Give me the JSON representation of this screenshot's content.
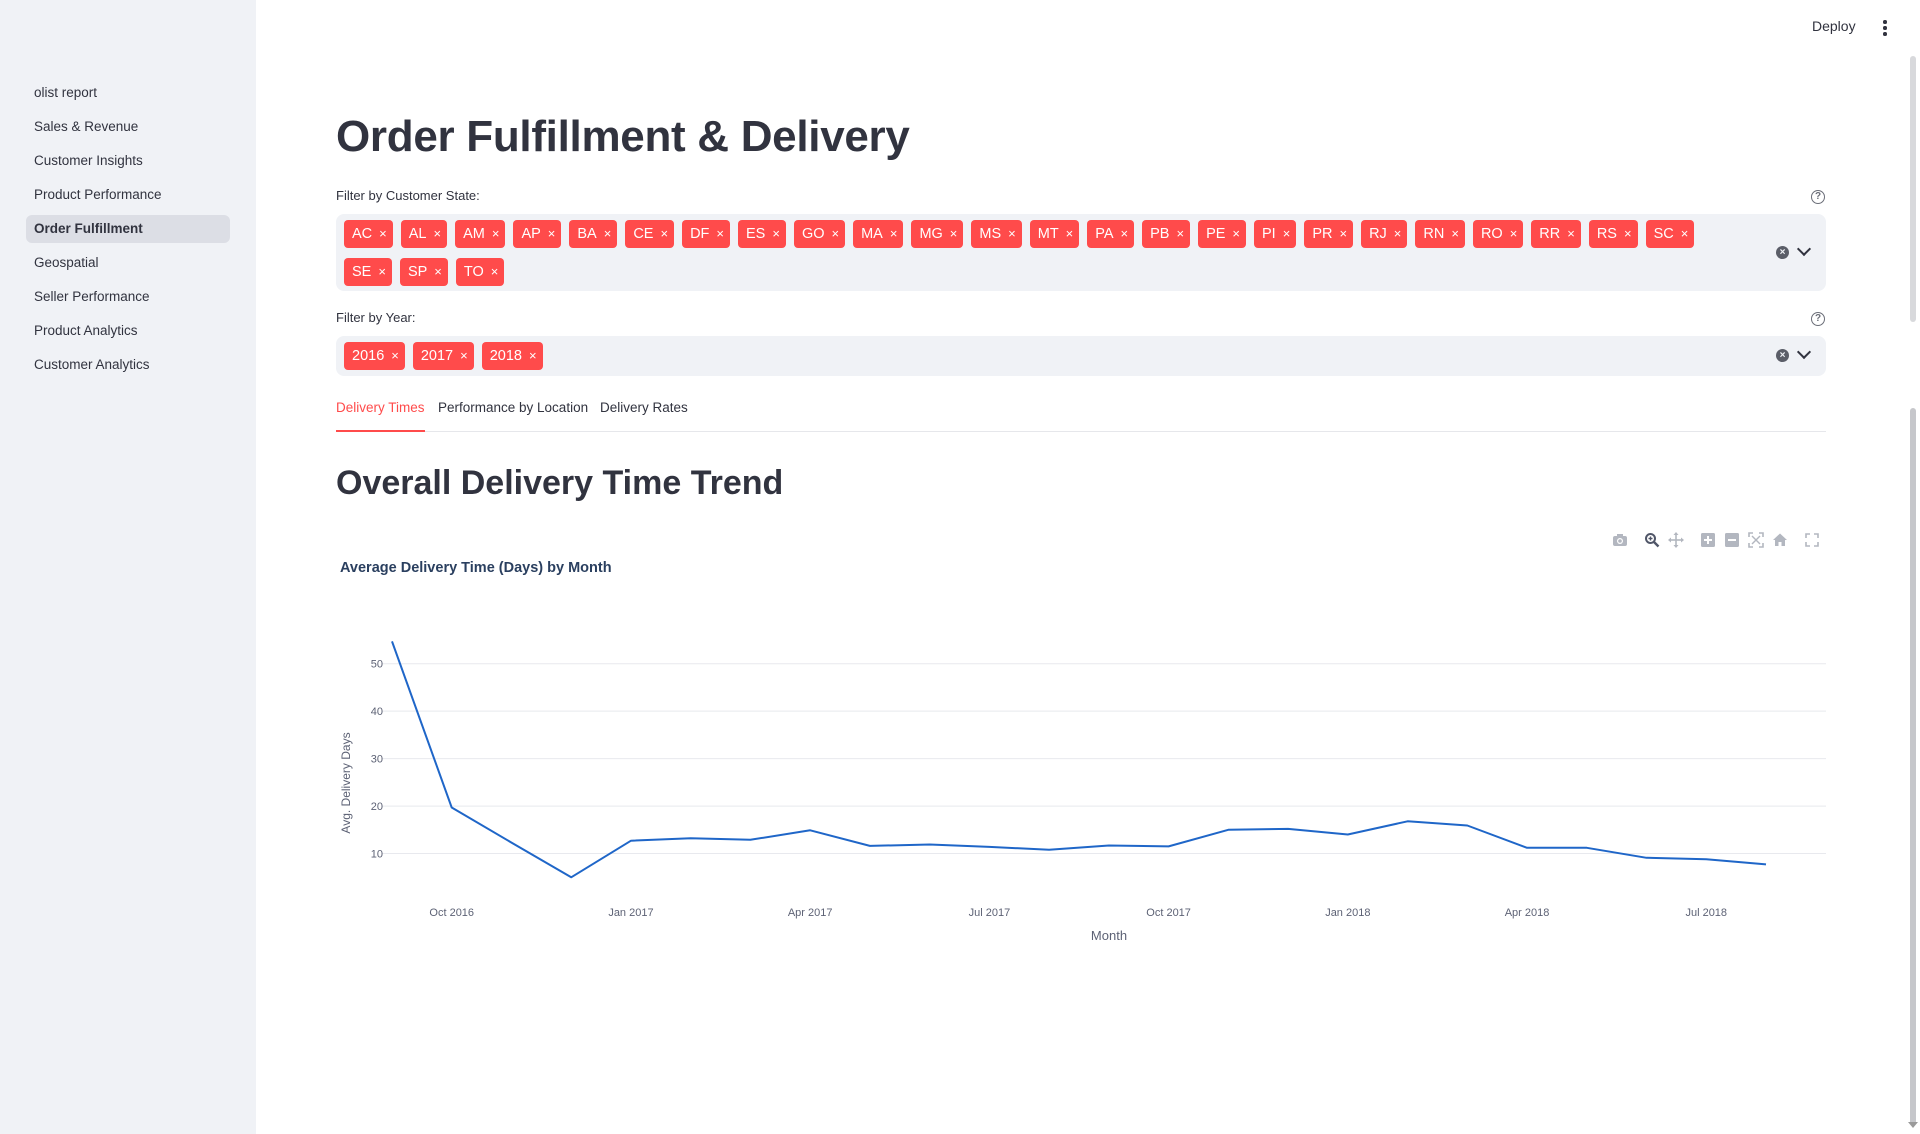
{
  "header": {
    "deploy_label": "Deploy"
  },
  "sidebar": {
    "items": [
      {
        "label": "olist report"
      },
      {
        "label": "Sales & Revenue"
      },
      {
        "label": "Customer Insights"
      },
      {
        "label": "Product Performance"
      },
      {
        "label": "Order Fulfillment",
        "active": true
      },
      {
        "label": "Geospatial"
      },
      {
        "label": "Seller Performance"
      },
      {
        "label": "Product Analytics"
      },
      {
        "label": "Customer Analytics"
      }
    ]
  },
  "main": {
    "title": "Order Fulfillment & Delivery",
    "state_filter": {
      "label": "Filter by Customer State:",
      "help": "?",
      "chips": [
        "AC",
        "AL",
        "AM",
        "AP",
        "BA",
        "CE",
        "DF",
        "ES",
        "GO",
        "MA",
        "MG",
        "MS",
        "MT",
        "PA",
        "PB",
        "PE",
        "PI",
        "PR",
        "RJ",
        "RN",
        "RO",
        "RR",
        "RS",
        "SC",
        "SE",
        "SP",
        "TO"
      ]
    },
    "year_filter": {
      "label": "Filter by Year:",
      "help": "?",
      "chips": [
        "2016",
        "2017",
        "2018"
      ]
    },
    "chip_remove_glyph": "×",
    "tabs": [
      {
        "label": "Delivery Times",
        "active": true
      },
      {
        "label": "Performance by Location"
      },
      {
        "label": "Delivery Rates"
      }
    ],
    "section_title": "Overall Delivery Time Trend",
    "modebar_icons": [
      "camera-icon",
      "zoom-icon",
      "pan-icon",
      "zoom-in-icon",
      "zoom-out-icon",
      "autoscale-icon",
      "reset-axes-home-icon",
      "fullscreen-icon"
    ],
    "line_color": "#1f66c8"
  },
  "chart_data": {
    "type": "line",
    "title": "Average Delivery Time (Days) by Month",
    "xlabel": "Month",
    "ylabel": "Avg. Delivery Days",
    "x": [
      "2016-09",
      "2016-10",
      "2016-11",
      "2016-12",
      "2017-01",
      "2017-02",
      "2017-03",
      "2017-04",
      "2017-05",
      "2017-06",
      "2017-07",
      "2017-08",
      "2017-09",
      "2017-10",
      "2017-11",
      "2017-12",
      "2018-01",
      "2018-02",
      "2018-03",
      "2018-04",
      "2018-05",
      "2018-06",
      "2018-07",
      "2018-08"
    ],
    "values": [
      54.7,
      19.7,
      12.3,
      5.0,
      12.7,
      13.2,
      12.9,
      14.9,
      11.6,
      11.9,
      11.4,
      10.8,
      11.7,
      11.5,
      15.0,
      15.2,
      14.0,
      16.8,
      15.9,
      11.2,
      11.2,
      9.1,
      8.8,
      7.7
    ],
    "x_tick_labels": [
      "Oct 2016",
      "Jan 2017",
      "Apr 2017",
      "Jul 2017",
      "Oct 2017",
      "Jan 2018",
      "Apr 2018",
      "Jul 2018"
    ],
    "x_tick_months": [
      "2016-10",
      "2017-01",
      "2017-04",
      "2017-07",
      "2017-10",
      "2018-01",
      "2018-04",
      "2018-07"
    ],
    "y_ticks": [
      10,
      20,
      30,
      40,
      50
    ],
    "ylim": [
      4,
      55
    ],
    "grid": true,
    "legend": "none"
  }
}
